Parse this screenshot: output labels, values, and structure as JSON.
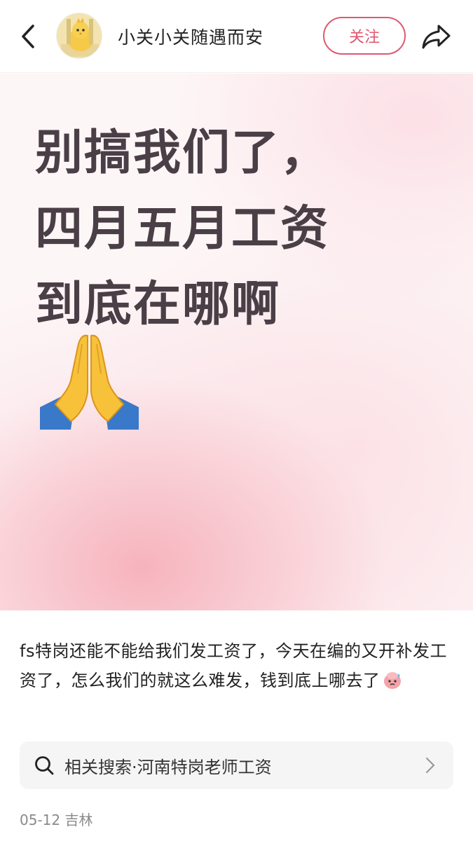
{
  "header": {
    "author_name": "小关小关随遇而安",
    "follow_label": "关注",
    "icons": {
      "back": "back-arrow-icon",
      "share": "share-icon",
      "avatar": "chick-avatar"
    }
  },
  "post_image": {
    "headline_line1": "别搞我们了，",
    "headline_line2_before": "四月五月",
    "headline_line2_highlight": "工资",
    "headline_line3": "到底在哪啊",
    "emoji": "folded-hands-emoji",
    "colors": {
      "text": "#4a3f46",
      "highlight": "#8fe05a",
      "pink": "#f6b0ba"
    }
  },
  "post": {
    "body": "fs特岗还能不能给我们发工资了，今天在编的又开补发工资了，怎么我们的就这么难发，钱到底上哪去了",
    "emoji": "sweating-face-emoji"
  },
  "related_search": {
    "label": "相关搜索·河南特岗老师工资"
  },
  "meta": {
    "date_location": "05-12 吉林"
  },
  "accent_color": "#e0586f"
}
